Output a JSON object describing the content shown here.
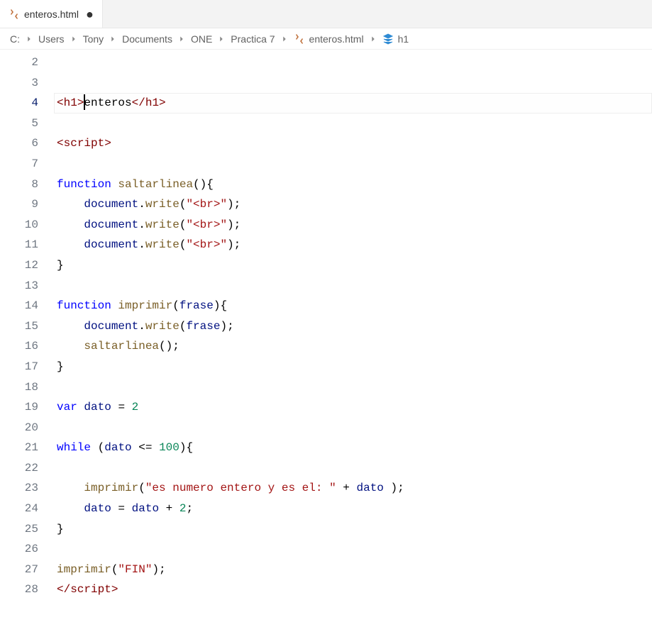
{
  "tab": {
    "filename": "enteros.html",
    "modified": true
  },
  "breadcrumb": {
    "parts": [
      "C:",
      "Users",
      "Tony",
      "Documents",
      "ONE",
      "Practica 7"
    ],
    "file": "enteros.html",
    "symbol": "h1"
  },
  "editor": {
    "activeLine": 4,
    "lines": [
      {
        "n": 2,
        "tokens": []
      },
      {
        "n": 3,
        "tokens": []
      },
      {
        "n": 4,
        "tokens": [
          {
            "c": "t-brk",
            "t": "<"
          },
          {
            "c": "t-tag",
            "t": "h1"
          },
          {
            "c": "t-brk",
            "t": ">"
          },
          {
            "c": "cursor",
            "t": ""
          },
          {
            "c": "t-txt",
            "t": "enteros"
          },
          {
            "c": "t-brk",
            "t": "</"
          },
          {
            "c": "t-tag",
            "t": "h1"
          },
          {
            "c": "t-brk",
            "t": ">"
          }
        ]
      },
      {
        "n": 5,
        "tokens": []
      },
      {
        "n": 6,
        "tokens": [
          {
            "c": "t-brk",
            "t": "<"
          },
          {
            "c": "t-tag",
            "t": "script"
          },
          {
            "c": "t-brk",
            "t": ">"
          }
        ]
      },
      {
        "n": 7,
        "tokens": []
      },
      {
        "n": 8,
        "tokens": [
          {
            "c": "t-kw",
            "t": "function"
          },
          {
            "c": "",
            "t": " "
          },
          {
            "c": "t-fn",
            "t": "saltarlinea"
          },
          {
            "c": "t-pn",
            "t": "()"
          },
          {
            "c": "t-brc",
            "t": "{"
          }
        ]
      },
      {
        "n": 9,
        "indent": 1,
        "tokens": [
          {
            "c": "t-var",
            "t": "document"
          },
          {
            "c": "t-pn",
            "t": "."
          },
          {
            "c": "t-fn",
            "t": "write"
          },
          {
            "c": "t-pn",
            "t": "("
          },
          {
            "c": "t-str",
            "t": "\"<br>\""
          },
          {
            "c": "t-pn",
            "t": ");"
          }
        ]
      },
      {
        "n": 10,
        "indent": 1,
        "tokens": [
          {
            "c": "t-var",
            "t": "document"
          },
          {
            "c": "t-pn",
            "t": "."
          },
          {
            "c": "t-fn",
            "t": "write"
          },
          {
            "c": "t-pn",
            "t": "("
          },
          {
            "c": "t-str",
            "t": "\"<br>\""
          },
          {
            "c": "t-pn",
            "t": ");"
          }
        ]
      },
      {
        "n": 11,
        "indent": 1,
        "tokens": [
          {
            "c": "t-var",
            "t": "document"
          },
          {
            "c": "t-pn",
            "t": "."
          },
          {
            "c": "t-fn",
            "t": "write"
          },
          {
            "c": "t-pn",
            "t": "("
          },
          {
            "c": "t-str",
            "t": "\"<br>\""
          },
          {
            "c": "t-pn",
            "t": ");"
          }
        ]
      },
      {
        "n": 12,
        "tokens": [
          {
            "c": "t-brc",
            "t": "}"
          }
        ]
      },
      {
        "n": 13,
        "tokens": []
      },
      {
        "n": 14,
        "tokens": [
          {
            "c": "t-kw",
            "t": "function"
          },
          {
            "c": "",
            "t": " "
          },
          {
            "c": "t-fn",
            "t": "imprimir"
          },
          {
            "c": "t-pn",
            "t": "("
          },
          {
            "c": "t-prm",
            "t": "frase"
          },
          {
            "c": "t-pn",
            "t": ")"
          },
          {
            "c": "t-brc",
            "t": "{"
          }
        ]
      },
      {
        "n": 15,
        "indent": 1,
        "tokens": [
          {
            "c": "t-var",
            "t": "document"
          },
          {
            "c": "t-pn",
            "t": "."
          },
          {
            "c": "t-fn",
            "t": "write"
          },
          {
            "c": "t-pn",
            "t": "("
          },
          {
            "c": "t-var",
            "t": "frase"
          },
          {
            "c": "t-pn",
            "t": ");"
          }
        ]
      },
      {
        "n": 16,
        "indent": 1,
        "tokens": [
          {
            "c": "t-fn",
            "t": "saltarlinea"
          },
          {
            "c": "t-pn",
            "t": "();"
          }
        ]
      },
      {
        "n": 17,
        "tokens": [
          {
            "c": "t-brc",
            "t": "}"
          }
        ]
      },
      {
        "n": 18,
        "tokens": []
      },
      {
        "n": 19,
        "tokens": [
          {
            "c": "t-kw",
            "t": "var"
          },
          {
            "c": "",
            "t": " "
          },
          {
            "c": "t-var",
            "t": "dato"
          },
          {
            "c": "",
            "t": " "
          },
          {
            "c": "t-op",
            "t": "="
          },
          {
            "c": "",
            "t": " "
          },
          {
            "c": "t-num",
            "t": "2"
          }
        ]
      },
      {
        "n": 20,
        "tokens": []
      },
      {
        "n": 21,
        "tokens": [
          {
            "c": "t-kw",
            "t": "while"
          },
          {
            "c": "",
            "t": " "
          },
          {
            "c": "t-pn",
            "t": "("
          },
          {
            "c": "t-var",
            "t": "dato"
          },
          {
            "c": "",
            "t": " "
          },
          {
            "c": "t-op",
            "t": "<="
          },
          {
            "c": "",
            "t": " "
          },
          {
            "c": "t-num",
            "t": "100"
          },
          {
            "c": "t-pn",
            "t": ")"
          },
          {
            "c": "t-brc",
            "t": "{"
          }
        ]
      },
      {
        "n": 22,
        "indent": 1,
        "tokens": []
      },
      {
        "n": 23,
        "indent": 1,
        "tokens": [
          {
            "c": "t-fn",
            "t": "imprimir"
          },
          {
            "c": "t-pn",
            "t": "("
          },
          {
            "c": "t-str",
            "t": "\"es numero entero y es el: \""
          },
          {
            "c": "",
            "t": " "
          },
          {
            "c": "t-op",
            "t": "+"
          },
          {
            "c": "",
            "t": " "
          },
          {
            "c": "t-var",
            "t": "dato"
          },
          {
            "c": "",
            "t": " "
          },
          {
            "c": "t-pn",
            "t": ");"
          }
        ]
      },
      {
        "n": 24,
        "indent": 1,
        "tokens": [
          {
            "c": "t-var",
            "t": "dato"
          },
          {
            "c": "",
            "t": " "
          },
          {
            "c": "t-op",
            "t": "="
          },
          {
            "c": "",
            "t": " "
          },
          {
            "c": "t-var",
            "t": "dato"
          },
          {
            "c": "",
            "t": " "
          },
          {
            "c": "t-op",
            "t": "+"
          },
          {
            "c": "",
            "t": " "
          },
          {
            "c": "t-num",
            "t": "2"
          },
          {
            "c": "t-pn",
            "t": ";"
          }
        ]
      },
      {
        "n": 25,
        "tokens": [
          {
            "c": "t-brc",
            "t": "}"
          }
        ]
      },
      {
        "n": 26,
        "tokens": []
      },
      {
        "n": 27,
        "tokens": [
          {
            "c": "t-fn",
            "t": "imprimir"
          },
          {
            "c": "t-pn",
            "t": "("
          },
          {
            "c": "t-str",
            "t": "\"FIN\""
          },
          {
            "c": "t-pn",
            "t": ");"
          }
        ]
      },
      {
        "n": 28,
        "tokens": [
          {
            "c": "t-brk",
            "t": "</"
          },
          {
            "c": "t-tag",
            "t": "script"
          },
          {
            "c": "t-brk",
            "t": ">"
          }
        ]
      }
    ]
  }
}
